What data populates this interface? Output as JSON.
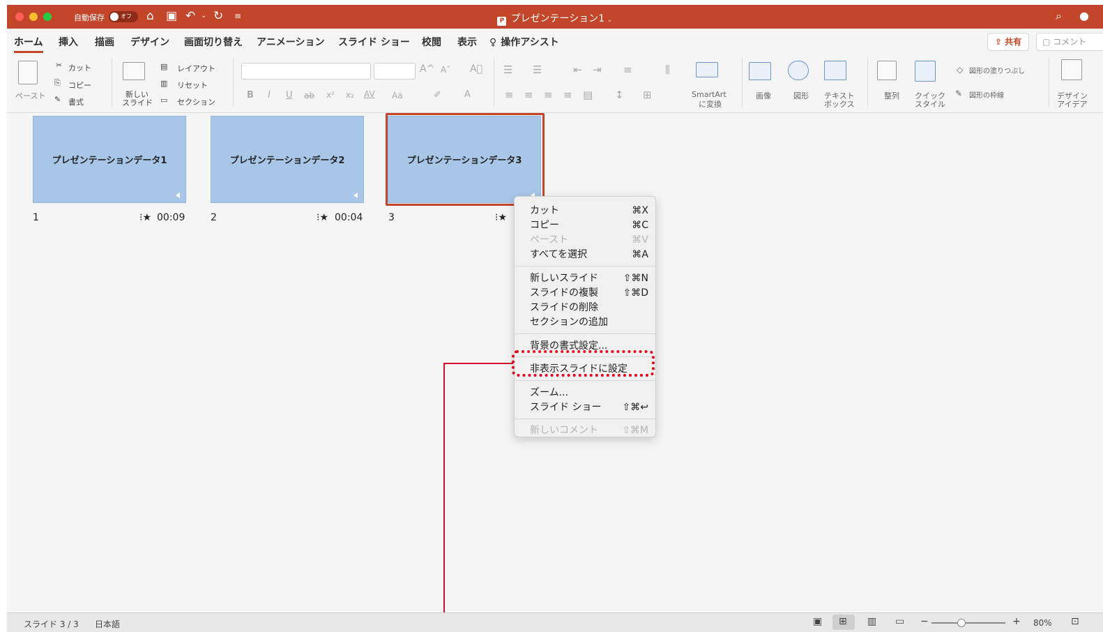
{
  "titlebar": {
    "autosave_label": "自動保存",
    "autosave_state": "オフ",
    "document_title": "プレゼンテーション1",
    "title_chevron": "⌄",
    "accent_color": "#c3462b"
  },
  "tabs": [
    {
      "label": "ホーム",
      "active": true
    },
    {
      "label": "挿入"
    },
    {
      "label": "描画"
    },
    {
      "label": "デザイン"
    },
    {
      "label": "画面切り替え"
    },
    {
      "label": "アニメーション"
    },
    {
      "label": "スライド ショー"
    },
    {
      "label": "校閲"
    },
    {
      "label": "表示"
    },
    {
      "label": "操作アシスト"
    }
  ],
  "header_buttons": {
    "share": "共有",
    "comment": "コメント"
  },
  "ribbon": {
    "paste": "ペースト",
    "cut": "カット",
    "copy": "コピー",
    "format": "書式",
    "new_slide_line1": "新しい",
    "new_slide_line2": "スライド",
    "layout": "レイアウト",
    "reset": "リセット",
    "section": "セクション",
    "bold": "B",
    "italic": "I",
    "underline": "U",
    "strike": "ab",
    "superscript": "x²",
    "subscript": "x₂",
    "spacing": "AV",
    "change_case": "Aa",
    "grow_font": "A^",
    "shrink_font": "Aˇ",
    "font_color": "A",
    "smartart_line1": "SmartArt",
    "smartart_line2": "に変換",
    "picture": "画像",
    "shapes": "図形",
    "textbox_line1": "テキスト",
    "textbox_line2": "ボックス",
    "arrange": "整列",
    "quick_style_line1": "クイック",
    "quick_style_line2": "スタイル",
    "shape_fill": "図形の塗りつぶし",
    "shape_outline": "図形の枠線",
    "design_ideas_line1": "デザイン",
    "design_ideas_line2": "アイデア"
  },
  "slides": [
    {
      "number": "1",
      "title": "プレゼンテーションデータ1",
      "duration": "00:09"
    },
    {
      "number": "2",
      "title": "プレゼンテーションデータ2",
      "duration": "00:04"
    },
    {
      "number": "3",
      "title": "プレゼンテーションデータ3",
      "duration": ""
    }
  ],
  "context_menu": {
    "items": [
      {
        "label": "カット",
        "shortcut": "⌘X"
      },
      {
        "label": "コピー",
        "shortcut": "⌘C"
      },
      {
        "label": "ペースト",
        "shortcut": "⌘V",
        "disabled": true
      },
      {
        "label": "すべてを選択",
        "shortcut": "⌘A"
      },
      {
        "label": "新しいスライド",
        "shortcut": "⇧⌘N"
      },
      {
        "label": "スライドの複製",
        "shortcut": "⇧⌘D"
      },
      {
        "label": "スライドの削除",
        "shortcut": ""
      },
      {
        "label": "セクションの追加",
        "shortcut": ""
      },
      {
        "label": "背景の書式設定...",
        "shortcut": ""
      },
      {
        "label": "非表示スライドに設定",
        "shortcut": "",
        "highlighted": true
      },
      {
        "label": "ズーム...",
        "shortcut": ""
      },
      {
        "label": "スライド ショー",
        "shortcut": "⇧⌘↩"
      },
      {
        "label": "新しいコメント",
        "shortcut": "⇧⌘M",
        "disabled": true
      }
    ]
  },
  "status_bar": {
    "slide_position": "スライド 3 / 3",
    "language": "日本語",
    "zoom": "80%",
    "zoom_level_fraction": 0.4
  },
  "annotation_color": "#e3001b"
}
